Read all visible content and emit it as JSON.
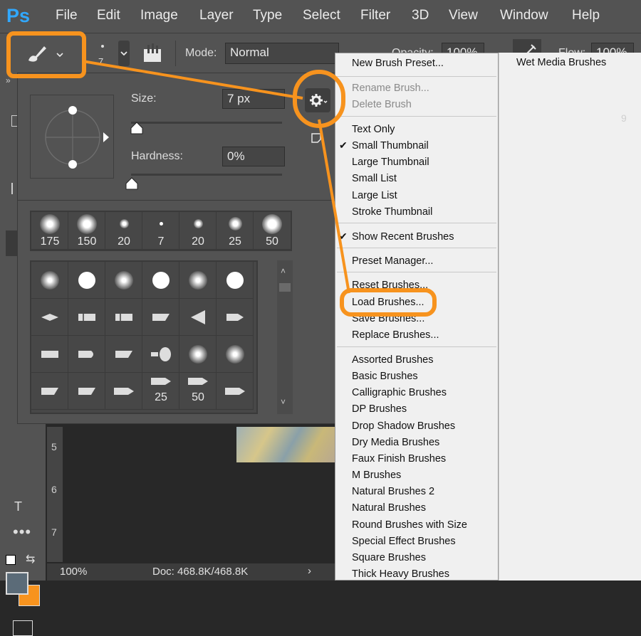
{
  "app": {
    "logo": "Ps"
  },
  "menubar": [
    "File",
    "Edit",
    "Image",
    "Layer",
    "Type",
    "Select",
    "Filter",
    "3D",
    "View",
    "Window",
    "Help"
  ],
  "options_bar": {
    "brush_size_value": "7",
    "mode_label": "Mode:",
    "mode_value": "Normal",
    "opacity_label": "Opacity:",
    "opacity_value": "100%",
    "flow_label": "Flow:",
    "flow_value": "100%"
  },
  "brush_panel": {
    "size_label": "Size:",
    "size_value": "7 px",
    "hardness_label": "Hardness:",
    "hardness_value": "0%",
    "recent_sizes": [
      "175",
      "150",
      "20",
      "7",
      "20",
      "25",
      "50"
    ],
    "grid_labels": [
      "25",
      "50"
    ]
  },
  "context_menu": {
    "items": [
      {
        "label": "New Brush Preset...",
        "enabled": true
      },
      {
        "label": "Rename Brush...",
        "enabled": false
      },
      {
        "label": "Delete Brush",
        "enabled": false
      },
      {
        "label": "Text Only",
        "enabled": true
      },
      {
        "label": "Small Thumbnail",
        "enabled": true,
        "checked": true
      },
      {
        "label": "Large Thumbnail",
        "enabled": true
      },
      {
        "label": "Small List",
        "enabled": true
      },
      {
        "label": "Large List",
        "enabled": true
      },
      {
        "label": "Stroke Thumbnail",
        "enabled": true
      },
      {
        "label": "Show Recent Brushes",
        "enabled": true,
        "checked": true
      },
      {
        "label": "Preset Manager...",
        "enabled": true
      },
      {
        "label": "Reset Brushes...",
        "enabled": true
      },
      {
        "label": "Load Brushes...",
        "enabled": true,
        "highlighted": true
      },
      {
        "label": "Save Brushes...",
        "enabled": true
      },
      {
        "label": "Replace Brushes...",
        "enabled": true
      },
      {
        "label": "Assorted Brushes",
        "enabled": true
      },
      {
        "label": "Basic Brushes",
        "enabled": true
      },
      {
        "label": "Calligraphic Brushes",
        "enabled": true
      },
      {
        "label": "DP Brushes",
        "enabled": true
      },
      {
        "label": "Drop Shadow Brushes",
        "enabled": true
      },
      {
        "label": "Dry Media Brushes",
        "enabled": true
      },
      {
        "label": "Faux Finish Brushes",
        "enabled": true
      },
      {
        "label": "M Brushes",
        "enabled": true
      },
      {
        "label": "Natural Brushes 2",
        "enabled": true
      },
      {
        "label": "Natural Brushes",
        "enabled": true
      },
      {
        "label": "Round Brushes with Size",
        "enabled": true
      },
      {
        "label": "Special Effect Brushes",
        "enabled": true
      },
      {
        "label": "Square Brushes",
        "enabled": true
      },
      {
        "label": "Thick Heavy Brushes",
        "enabled": true
      }
    ],
    "submenu_item": "Wet Media Brushes"
  },
  "status_bar": {
    "zoom": "100%",
    "doc": "Doc: 468.8K/468.8K"
  },
  "ruler": [
    "5",
    "6",
    "7"
  ],
  "ruler_top": "9",
  "colors": {
    "accent": "#f7931e",
    "foreground_swatch": "#5b6b78",
    "background_swatch": "#f7931e"
  }
}
